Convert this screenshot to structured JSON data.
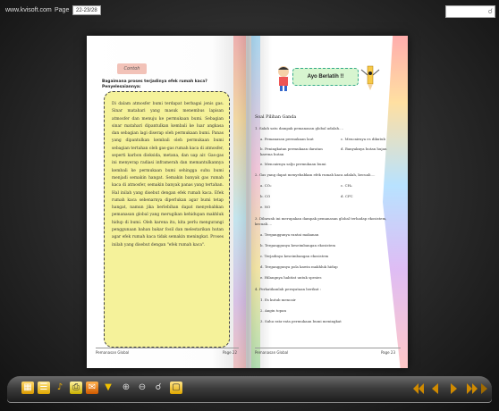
{
  "topbar": {
    "site": "www.kvisoft.com",
    "page_label": "Page",
    "page_value": "22-23/28"
  },
  "left_page": {
    "tab_label": "Contoh",
    "heading_line1": "Bagaimana proses terjadinya efek rumah kaca?",
    "heading_line2": "Penyelesaiannya:",
    "body": "Di dalam atmosfer bumi terdapat berbagai jenis gas. Sinar matahari yang masuk menembus lapisan atmosfer dan menuju ke permukaan bumi. Sebagian sinar matahari dipantulkan kembali ke luar angkasa dan sebagian lagi diserap oleh permukaan bumi. Panas yang dipantulkan kembali oleh permukaan bumi sebagian tertahan oleh gas-gas rumah kaca di atmosfer, seperti karbon dioksida, metana, dan uap air. Gas-gas ini menyerap radiasi inframerah dan memantulkannya kembali ke permukaan bumi sehingga suhu bumi menjadi semakin hangat. Semakin banyak gas rumah kaca di atmosfer, semakin banyak panas yang tertahan. Hal inilah yang disebut dengan efek rumah kaca. Efek rumah kaca sebenarnya diperlukan agar bumi tetap hangat, namun jika berlebihan dapat menyebabkan pemanasan global yang merugikan kehidupan makhluk hidup di bumi. Oleh karena itu, kita perlu mengurangi penggunaan bahan bakar fosil dan melestarikan hutan agar efek rumah kaca tidak semakin meningkat. Proses inilah yang disebut dengan \"efek rumah kaca\".",
    "footer_left": "Pemanasan Global",
    "footer_right": "Page 22"
  },
  "right_page": {
    "banner": "Ayo Berlatih !!",
    "soal_title": "Soal Pilihan Ganda",
    "q1": "1.  Salah satu dampak pemanasan global adalah....",
    "q1a": "a.  Pemanasan permukaan laut",
    "q1c": "c.  Mencairnya es dikutub",
    "q1b": "b.  Peningkatan permukaan daratan",
    "q1b2": "     karena hutan",
    "q1d": "d.  Banyaknya hutan hujan",
    "q1e": "e.  Mencairnya salju permukaan bumi",
    "q2": "2.  Gas yang dapat menyebabkan efek rumah kaca adalah, kecuali....",
    "q2a": "a.  CO₂",
    "q2c": "c.  CH₄",
    "q2b": "b.  CO",
    "q2d": "d.  CFC",
    "q2e": "e.  NO",
    "q3": "3.  Dibawah ini merupakan dampak pemanasan global terhadap ekosistem,",
    "q3b": "     kecuali....",
    "q3a": "a.  Terganggunya rantai makanan",
    "q3bb": "b.  Terganggunya keseimbangan ekosistem",
    "q3c": "c.  Terjadinya keseimbangan ekosistem",
    "q3d": "d.  Terganggunya pola kawin makhluk hidup",
    "q3e": "e.  Hilangnya habitat untuk spesies",
    "q4": "4.  Perhatikanlah pernyataan berikut :",
    "q4_1": "1.  Es kutub mencair",
    "q4_2": "2.  Angin topan",
    "q4_3": "3.  Suhu rata-rata permukaan bumi meningkat",
    "footer_left": "Pemanasan Global",
    "footer_right": "Page 23"
  },
  "toolbar": {
    "icons": [
      "thumbnails-icon",
      "bookmark-icon",
      "sound-icon",
      "print-icon",
      "share-icon",
      "download-icon",
      "zoom-in-icon",
      "zoom-out-icon",
      "search-icon",
      "fullscreen-icon"
    ],
    "nav_labels": [
      "First",
      "Prev",
      "Next",
      "Last",
      "Auto"
    ]
  },
  "colors": {
    "toolbar_icon_accent": "#f0b000",
    "nav_arrow": "#d08a00"
  }
}
